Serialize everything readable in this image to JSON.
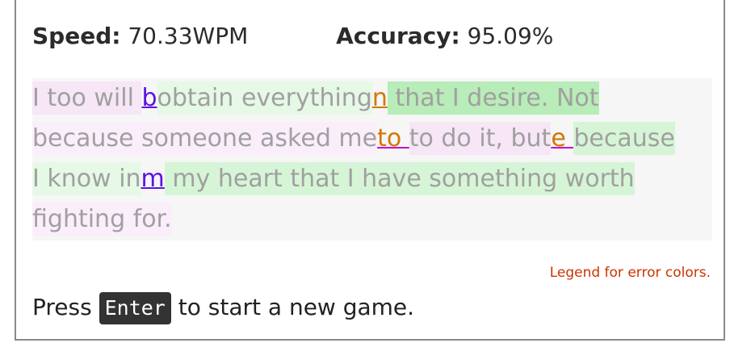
{
  "stats": {
    "speed_label": "Speed:",
    "speed_value": "70.33WPM",
    "accuracy_label": "Accuracy:",
    "accuracy_value": "95.09%"
  },
  "passage": {
    "segments": [
      "I too will ",
      "b",
      "obtain everything",
      "n",
      " that I desire. Not",
      "because someone asked me",
      "to ",
      "to do it, but",
      "e ",
      "because",
      "I know in",
      "m",
      " my heart that I have something worth",
      "fighting for."
    ]
  },
  "legend": {
    "label": "Legend for error colors."
  },
  "footer": {
    "prefix": "Press ",
    "key": "Enter",
    "suffix": " to start a new game."
  },
  "colors": {
    "insertion_error": "#5b12e6",
    "substitution_error": "#d07800",
    "extra_marker": "#c800c8",
    "legend_link": "#cc3300"
  }
}
